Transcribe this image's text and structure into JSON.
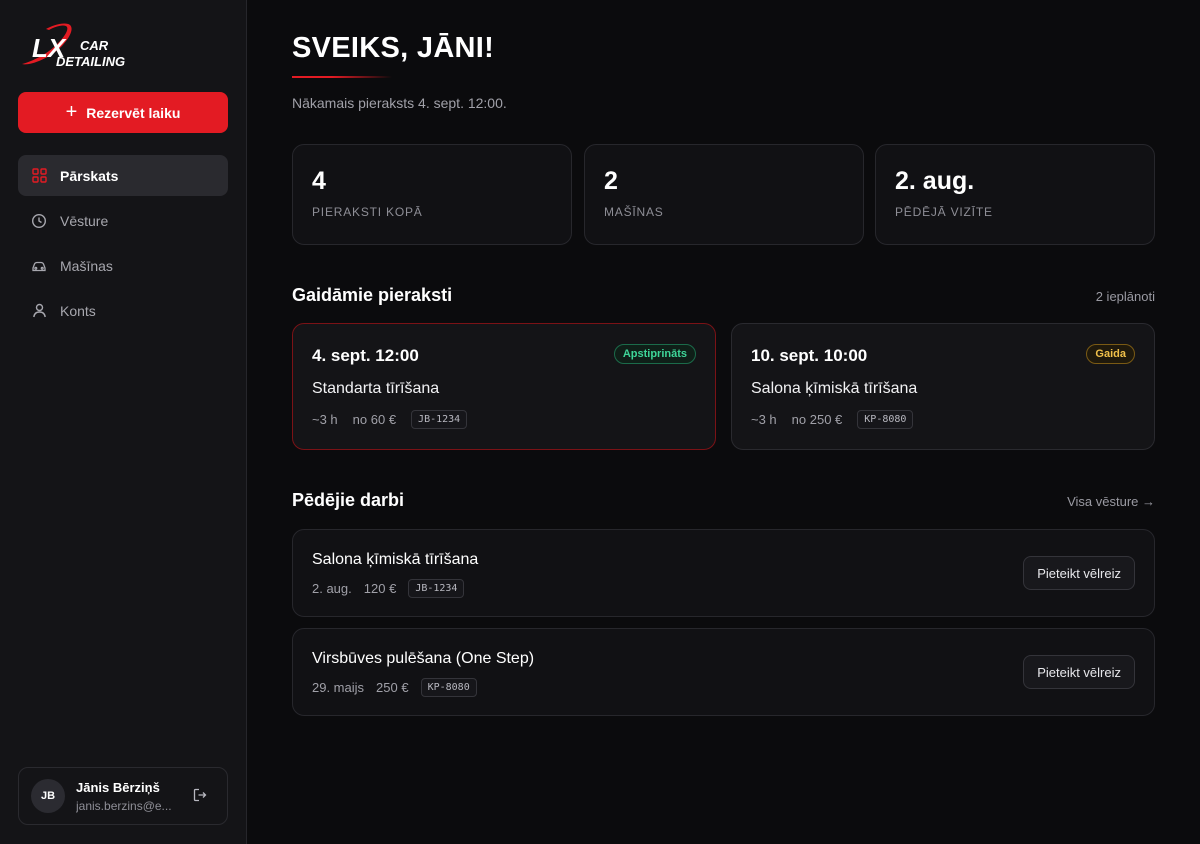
{
  "brand": {
    "logo_mark": "LX",
    "logo_line1": "CAR",
    "logo_line2": "DETAILING",
    "accent": "#e31b23"
  },
  "sidebar": {
    "cta_label": "Rezervēt laiku",
    "items": [
      {
        "label": "Pārskats",
        "icon": "grid-icon",
        "active": true
      },
      {
        "label": "Vēsture",
        "icon": "clock-icon",
        "active": false
      },
      {
        "label": "Mašīnas",
        "icon": "car-icon",
        "active": false
      },
      {
        "label": "Konts",
        "icon": "user-icon",
        "active": false
      }
    ],
    "user": {
      "initials": "JB",
      "name": "Jānis Bērziņš",
      "email": "janis.berzins@e..."
    }
  },
  "main": {
    "greeting": "SVEIKS, JĀNI!",
    "subtitle": "Nākamais pieraksts 4. sept. 12:00.",
    "stats": [
      {
        "value": "4",
        "label": "PIERAKSTI KOPĀ"
      },
      {
        "value": "2",
        "label": "MAŠĪNAS"
      },
      {
        "value": "2. aug.",
        "label": "PĒDĒJĀ VIZĪTE"
      }
    ],
    "upcoming": {
      "title": "Gaidāmie pieraksti",
      "count_label": "2 ieplānoti",
      "items": [
        {
          "date": "4. sept. 12:00",
          "service": "Standarta tīrīšana",
          "duration": "~3 h",
          "price": "no 60 €",
          "plate": "JB-1234",
          "status": "Apstiprināts",
          "status_color": "#3ed598"
        },
        {
          "date": "10. sept. 10:00",
          "service": "Salona ķīmiskā tīrīšana",
          "duration": "~3 h",
          "price": "no 250 €",
          "plate": "KP-8080",
          "status": "Gaida",
          "status_color": "#f0c04a"
        }
      ]
    },
    "recent": {
      "title": "Pēdējie darbi",
      "link_label": "Visa vēsture →",
      "items": [
        {
          "title": "Salona ķīmiskā tīrīšana",
          "date": "2. aug.",
          "price": "120 €",
          "plate": "JB-1234",
          "button": "Pieteikt vēlreiz"
        },
        {
          "title": "Virsbūves pulēšana (One Step)",
          "date": "29. maijs",
          "price": "250 €",
          "plate": "KP-8080",
          "button": "Pieteikt vēlreiz"
        }
      ]
    }
  }
}
